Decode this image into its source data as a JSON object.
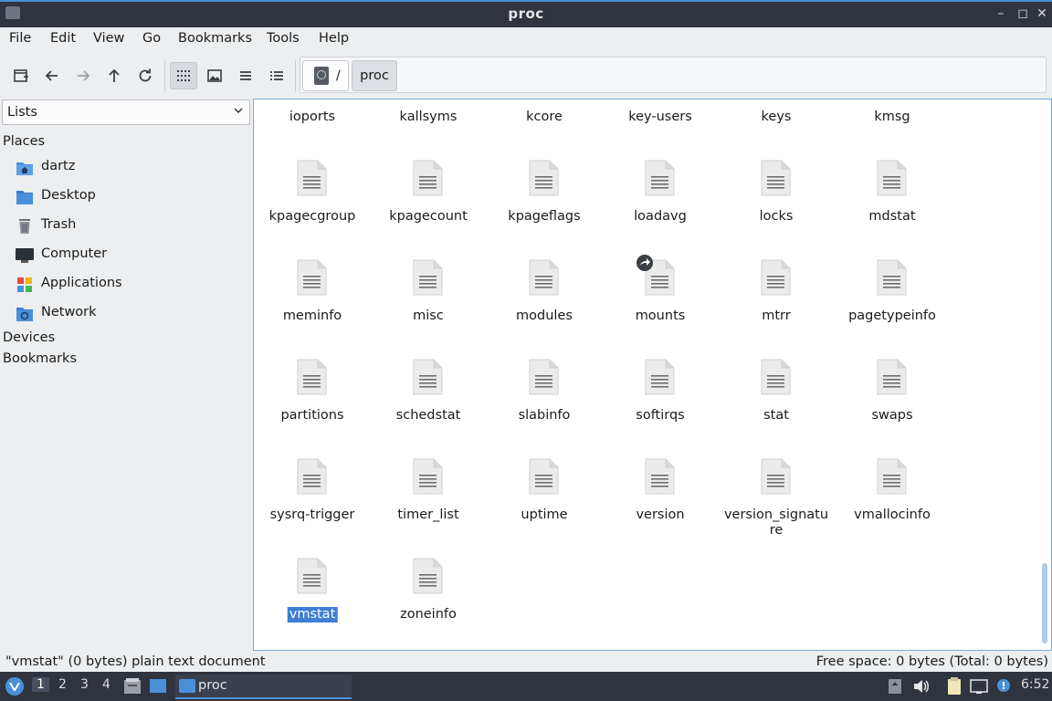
{
  "window": {
    "title": "proc"
  },
  "menu": [
    "File",
    "Edit",
    "View",
    "Go",
    "Bookmarks",
    "Tools",
    "Help"
  ],
  "path": {
    "root": "/",
    "current": "proc"
  },
  "sidebar": {
    "mode": "Lists",
    "places_heading": "Places",
    "places": [
      "dartz",
      "Desktop",
      "Trash",
      "Computer",
      "Applications",
      "Network"
    ],
    "devices_heading": "Devices",
    "bookmarks_heading": "Bookmarks"
  },
  "files": [
    "ioports",
    "kallsyms",
    "kcore",
    "key-users",
    "keys",
    "kmsg",
    "kpagecgroup",
    "kpagecount",
    "kpageflags",
    "loadavg",
    "locks",
    "mdstat",
    "meminfo",
    "misc",
    "modules",
    "mounts",
    "mtrr",
    "pagetypeinfo",
    "partitions",
    "schedstat",
    "slabinfo",
    "softirqs",
    "stat",
    "swaps",
    "sysrq-trigger",
    "timer_list",
    "uptime",
    "version",
    "version_signature",
    "vmallocinfo",
    "vmstat",
    "zoneinfo"
  ],
  "selected_file": "vmstat",
  "symlink_file": "mounts",
  "status": {
    "left": "\"vmstat\" (0 bytes) plain text document",
    "right": "Free space: 0 bytes (Total: 0 bytes)"
  },
  "taskbar": {
    "workspaces": [
      "1",
      "2",
      "3",
      "4"
    ],
    "active_workspace": "1",
    "task_title": "proc",
    "clock": "6:52"
  },
  "colors": {
    "accent": "#4a90d9",
    "selection": "#3d7fd4",
    "titlebar": "#2f343f"
  }
}
